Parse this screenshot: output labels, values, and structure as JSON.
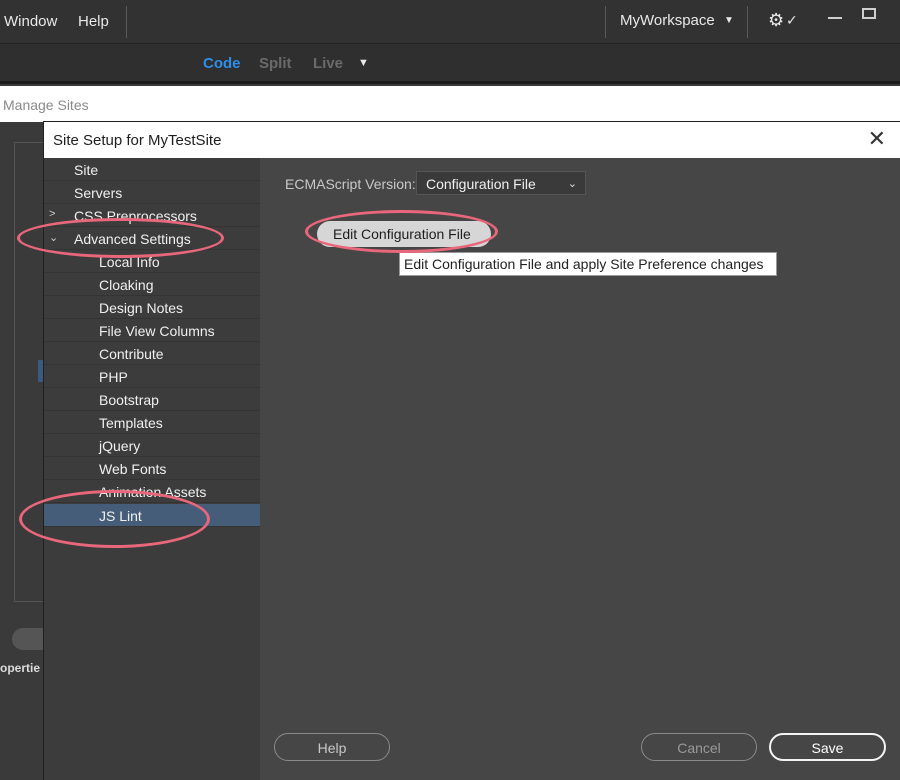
{
  "menubar": {
    "window_label": "Window",
    "help_label": "Help",
    "workspace_label": "MyWorkspace"
  },
  "viewbar": {
    "code": "Code",
    "split": "Split",
    "live": "Live"
  },
  "manage_sites": {
    "title": "Manage Sites",
    "behind_label": "opertie"
  },
  "dialog": {
    "title": "Site Setup for MyTestSite",
    "nav": [
      {
        "label": "Site"
      },
      {
        "label": "Servers"
      },
      {
        "label": "CSS Preprocessors"
      },
      {
        "label": "Advanced Settings"
      },
      {
        "label": "Local Info"
      },
      {
        "label": "Cloaking"
      },
      {
        "label": "Design Notes"
      },
      {
        "label": "File View Columns"
      },
      {
        "label": "Contribute"
      },
      {
        "label": "PHP"
      },
      {
        "label": "Bootstrap"
      },
      {
        "label": "Templates"
      },
      {
        "label": "jQuery"
      },
      {
        "label": "Web Fonts"
      },
      {
        "label": "Animation Assets"
      },
      {
        "label": "JS Lint"
      }
    ],
    "ecma_label": "ECMAScript Version:",
    "ecma_value": "Configuration File",
    "edit_button": "Edit Configuration File",
    "tooltip": "Edit Configuration File and apply Site Preference changes",
    "help_button": "Help",
    "cancel_button": "Cancel",
    "save_button": "Save"
  },
  "colors": {
    "accent": "#2f8ee8",
    "annotation": "#e8677b",
    "selected_nav": "#465d7a"
  }
}
